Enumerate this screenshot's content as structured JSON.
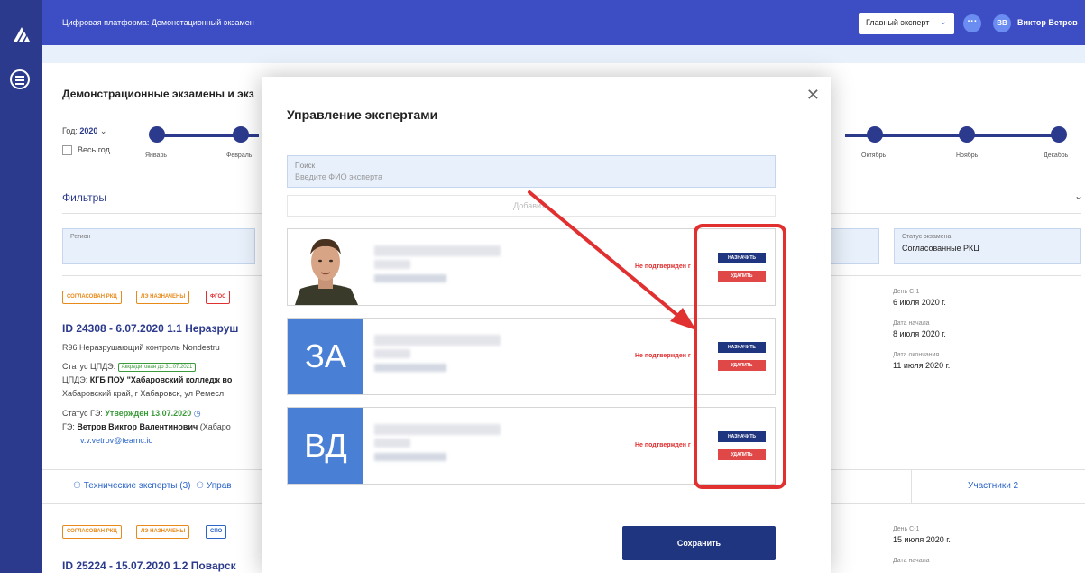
{
  "topbar": {
    "title": "Цифровая платформа: Демонстационный экзамен",
    "role": "Главный эксперт",
    "user_initials": "ВВ",
    "user_name": "Виктор Ветров"
  },
  "background": {
    "page_title": "Демонстрационные экзамены и экз",
    "year_label": "Год:",
    "year_value": "2020",
    "whole_year": "Весь год",
    "months": [
      "Январь",
      "Февраль",
      "Октябрь",
      "Ноябрь",
      "Декабрь"
    ],
    "filters": "Фильтры",
    "region_label": "Регион",
    "exam_status_label": "Статус экзамена",
    "exam_status_value": "Согласованные РКЦ",
    "card1": {
      "badges": [
        "СОГЛАСОВАН РКЦ",
        "ЛЭ НАЗНАЧЕНЫ",
        "ФГОС"
      ],
      "title": "ID 24308 - 6.07.2020 1.1 Неразруш",
      "line1": "R96  Неразрушающий контроль  Nondestru",
      "cpde_status_label": "Статус ЦПДЭ:",
      "cpde_badge": "Аккредитован до 31.07.2021",
      "cpde_label": "ЦПДЭ:",
      "cpde_name": "КГБ ПОУ \"Хабаровский колледж во",
      "address": "Хабаровский край, г Хабаровск, ул Ремесл",
      "ge_status_label": "Статус ГЭ:",
      "ge_status": "Утвержден 13.07.2020",
      "ge_label": "ГЭ:",
      "ge_name": "Ветров Виктор Валентинович",
      "ge_suffix": "(Хабаро",
      "email": "v.v.vetrov@teamc.io",
      "day_c1_label": "День С-1",
      "day_c1": "6 июля 2020 г.",
      "start_label": "Дата начала",
      "start": "8 июля 2020 г.",
      "end_label": "Дата окончания",
      "end": "11 июля 2020 г."
    },
    "tab_tech": "Технические эксперты (3)",
    "tab_manage": "Управ",
    "tab_participants": "Участники 2",
    "card2": {
      "badges": [
        "СОГЛАСОВАН РКЦ",
        "ЛЭ НАЗНАЧЕНЫ",
        "СПО"
      ],
      "title": "ID 25224 - 15.07.2020 1.2 Поварск",
      "day_c1_label": "День С-1",
      "day_c1": "15 июля 2020 г.",
      "start_label": "Дата начала"
    }
  },
  "modal": {
    "title": "Управление экспертами",
    "search_label": "Поиск",
    "search_placeholder": "Введите ФИО эксперта",
    "add_label": "Добавить",
    "experts": [
      {
        "initials": "",
        "has_photo": true,
        "status": "Не подтвержден г",
        "assign": "НАЗНАЧИТЬ",
        "delete": "УДАЛИТЬ"
      },
      {
        "initials": "ЗА",
        "has_photo": false,
        "status": "Не подтвержден г",
        "assign": "НАЗНАЧИТЬ",
        "delete": "УДАЛИТЬ"
      },
      {
        "initials": "ВД",
        "has_photo": false,
        "status": "Не подтвержден г",
        "assign": "НАЗНАЧИТЬ",
        "delete": "УДАЛИТЬ"
      }
    ],
    "save_label": "Сохранить"
  },
  "colors": {
    "sidebar": "#2b3a8c",
    "topbar": "#3d4ec4",
    "primary_button": "#1f3580",
    "danger": "#e04848",
    "highlight": "#e03030",
    "initials_bg": "#4a7fd6"
  }
}
